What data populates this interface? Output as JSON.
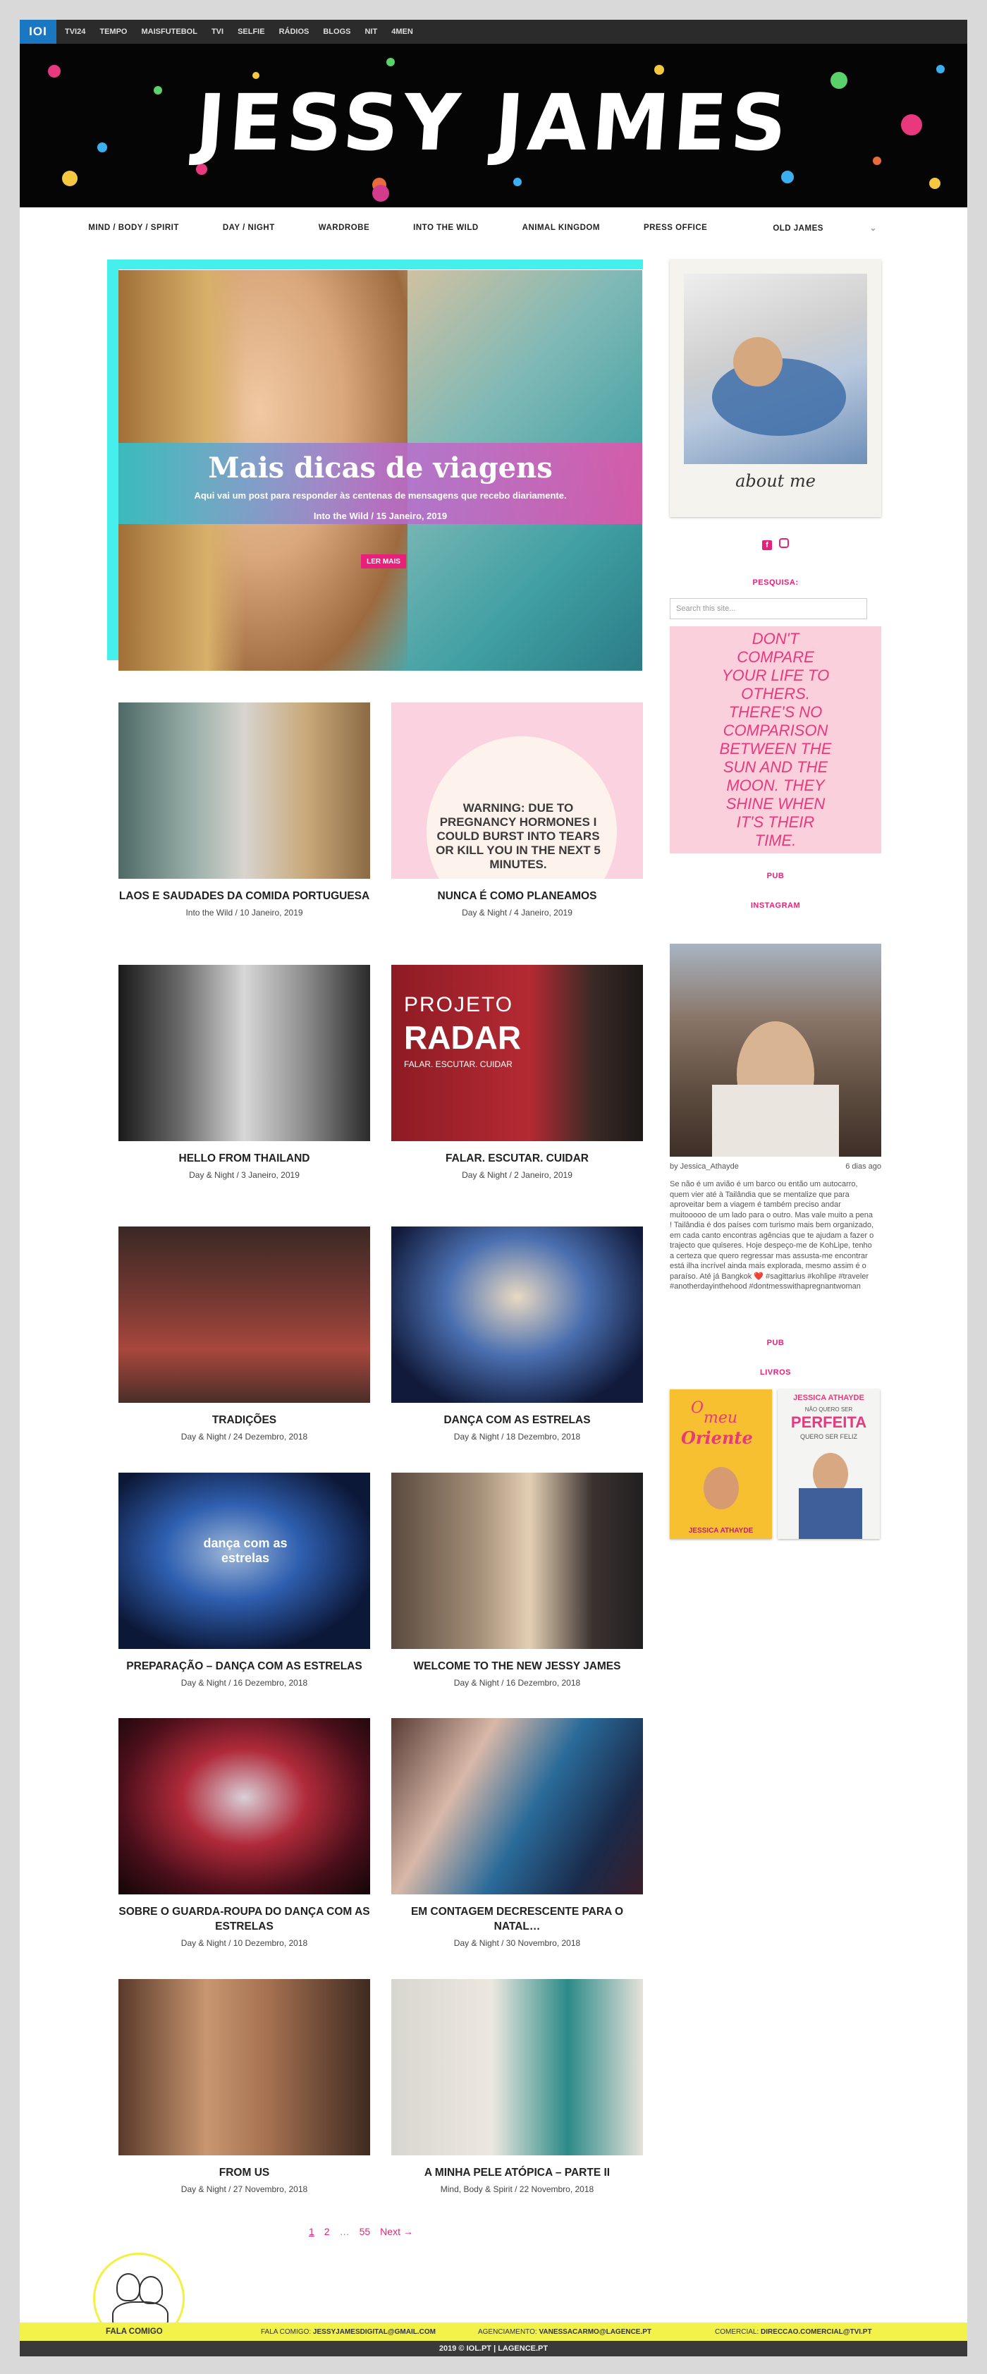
{
  "topbar": {
    "logo": "IOI",
    "links": [
      "TVI24",
      "TEMPO",
      "MAISFUTEBOL",
      "TVI",
      "SELFIE",
      "RÁDIOS",
      "BLOGS",
      "NIT",
      "4MEN"
    ]
  },
  "banner": {
    "title": "JESSY JAMES"
  },
  "nav": {
    "items": [
      "MIND / BODY / SPIRIT",
      "DAY / NIGHT",
      "WARDROBE",
      "INTO THE WILD",
      "ANIMAL KINGDOM",
      "PRESS OFFICE",
      "OLD JAMES"
    ],
    "dropdown_icon": "chevron-down-icon"
  },
  "hero": {
    "title": "Mais dicas de viagens",
    "subtitle": "Aqui vai um post para responder às centenas de mensagens que recebo diariamente.",
    "meta": "Into the Wild / 15 Janeiro, 2019",
    "button": "LER MAIS"
  },
  "posts": [
    {
      "title": "LAOS E SAUDADES DA COMIDA PORTUGUESA",
      "meta": "Into the Wild / 10 Janeiro, 2019"
    },
    {
      "title": "NUNCA É COMO PLANEAMOS",
      "meta": "Day & Night / 4 Janeiro, 2019",
      "image_text": "WARNING: DUE TO PREGNANCY HORMONES I COULD BURST INTO TEARS OR KILL YOU IN THE NEXT 5 MINUTES."
    },
    {
      "title": "HELLO FROM THAILAND",
      "meta": "Day & Night / 3 Janeiro, 2019"
    },
    {
      "title": "FALAR. ESCUTAR. CUIDAR",
      "meta": "Day & Night / 2 Janeiro, 2019",
      "image_text": "PROJETO",
      "image_text2": "RADAR",
      "image_text3": "FALAR. ESCUTAR. CUIDAR"
    },
    {
      "title": "TRADIÇÕES",
      "meta": "Day & Night / 24 Dezembro, 2018"
    },
    {
      "title": "DANÇA COM AS ESTRELAS",
      "meta": "Day & Night / 18 Dezembro, 2018"
    },
    {
      "title": "PREPARAÇÃO – DANÇA COM AS ESTRELAS",
      "meta": "Day & Night / 16 Dezembro, 2018",
      "image_text": "dança com as estrelas"
    },
    {
      "title": "WELCOME TO THE NEW JESSY JAMES",
      "meta": "Day & Night / 16 Dezembro, 2018"
    },
    {
      "title": "SOBRE O GUARDA-ROUPA DO DANÇA COM AS ESTRELAS",
      "meta": "Day & Night / 10 Dezembro, 2018"
    },
    {
      "title": "EM CONTAGEM DECRESCENTE PARA O NATAL…",
      "meta": "Day & Night / 30 Novembro, 2018"
    },
    {
      "title": "FROM US",
      "meta": "Day & Night / 27 Novembro, 2018"
    },
    {
      "title": "A MINHA PELE ATÓPICA – PARTE II",
      "meta": "Mind, Body & Spirit / 22 Novembro, 2018"
    }
  ],
  "pagination": {
    "p1": "1",
    "p2": "2",
    "dots": "…",
    "last": "55",
    "next": "Next →"
  },
  "sidebar": {
    "about_caption": "about me",
    "social_icons": [
      "facebook-icon",
      "instagram-icon"
    ],
    "search_title": "PESQUISA:",
    "search_placeholder": "Search this site...",
    "quote": "DON'T COMPARE YOUR LIFE TO OTHERS. THERE'S NO COMPARISON BETWEEN THE SUN AND THE MOON. THEY SHINE WHEN IT'S THEIR TIME.",
    "pub1": "PUB",
    "instagram_title": "INSTAGRAM",
    "instagram_user": "by Jessica_Athayde",
    "instagram_time": "6 dias ago",
    "instagram_caption": "Se não é um avião é um barco ou então um autocarro, quem vier até à Tailândia que se mentalize que para aproveitar bem a viagem é também preciso andar muitooooo de um lado para o outro. Mas vale muito a pena ! Tailândia é dos países com turismo mais bem organizado, em cada canto encontras agências que te ajudam a fazer o trajecto que quiseres. Hoje despeço-me de KohLipe, tenho a certeza que quero regressar mas assusta-me encontrar está ilha incrível ainda mais explorada, mesmo assim é o paraíso. Até já Bangkok ❤️ #sagittarius #kohlipe #traveler #anotherdayinthehood #dontmesswithapregnantwoman",
    "pub2": "PUB",
    "books_title": "LIVROS",
    "book1": {
      "line1": "O",
      "line2": "meu",
      "line3": "Oriente",
      "author": "JESSICA ATHAYDE"
    },
    "book2": {
      "author": "JESSICA ATHAYDE",
      "line1": "NÃO QUERO SER",
      "line2": "PERFEITA",
      "line3": "QUERO SER FELIZ"
    }
  },
  "footer": {
    "label": "FALA COMIGO",
    "contact1_label": "FALA COMIGO:",
    "contact1": "JESSYJAMESDIGITAL@GMAIL.COM",
    "contact2_label": "AGENCIAMENTO:",
    "contact2": "VANESSACARMO@LAGENCE.PT",
    "contact3_label": "COMERCIAL:",
    "contact3": "DIRECCAO.COMERCIAL@TVI.PT",
    "copyright": "2019 © IOL.PT | LAGENCE.PT"
  },
  "colors": {
    "accent": "#e9207a",
    "cyan": "#45f0ec",
    "footer": "#f3f24a",
    "quote_bg": "#fbd0dd"
  }
}
